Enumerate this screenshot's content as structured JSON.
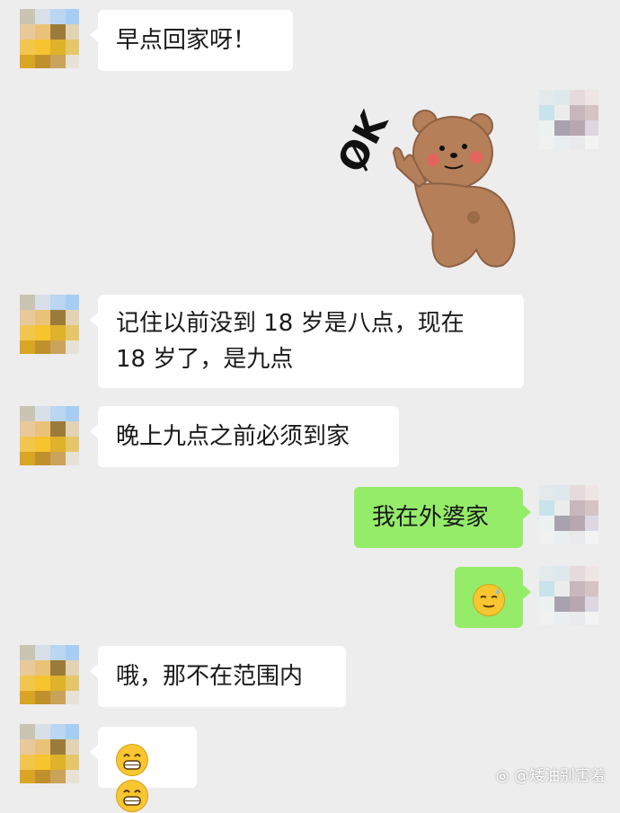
{
  "messages": [
    {
      "side": "left",
      "text": "早点回家呀！"
    },
    {
      "side": "right",
      "sticker": "ok-bear-sticker",
      "sticker_text": "OK"
    },
    {
      "side": "left",
      "line1": "记住以前没到 18 岁是八点，现在",
      "line2": "18 岁了，是九点"
    },
    {
      "side": "left",
      "text": "晚上九点之前必须到家"
    },
    {
      "side": "right",
      "text": "我在外婆家"
    },
    {
      "side": "right",
      "emoji": "sweat-smile-emoji"
    },
    {
      "side": "left",
      "text": "哦，那不在范围内"
    },
    {
      "side": "left",
      "emoji": "grinning-emoji-pair"
    }
  ],
  "watermark": "@矮油别害羞",
  "colors": {
    "background": "#ededed",
    "incoming_bubble": "#ffffff",
    "outgoing_bubble": "#95ec69"
  }
}
